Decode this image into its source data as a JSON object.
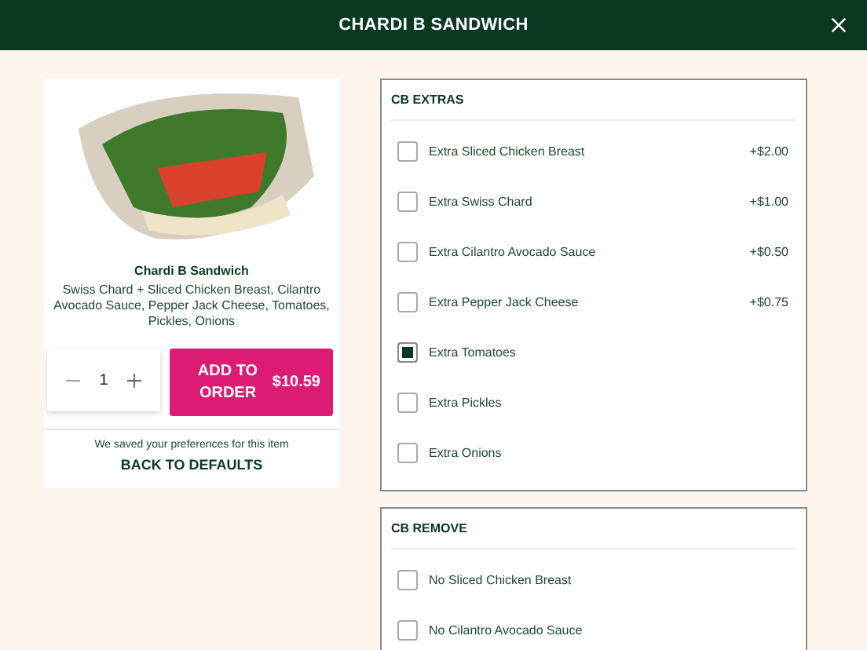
{
  "header": {
    "title": "CHARDI B SANDWICH"
  },
  "item": {
    "name": "Chardi B Sandwich",
    "description": "Swiss Chard + Sliced Chicken Breast, Cilantro Avocado Sauce, Pepper Jack Cheese, Tomatoes, Pickles, Onions",
    "quantity": "1",
    "add_button": {
      "label": "ADD TO ORDER",
      "price": "$10.59"
    },
    "saved_note": "We saved your preferences for this item",
    "reset_link": "BACK TO DEFAULTS"
  },
  "groups": [
    {
      "title": "CB EXTRAS",
      "options": [
        {
          "label": "Extra Sliced Chicken Breast",
          "price": "+$2.00",
          "checked": false
        },
        {
          "label": "Extra Swiss Chard",
          "price": "+$1.00",
          "checked": false
        },
        {
          "label": "Extra Cilantro Avocado Sauce",
          "price": "+$0.50",
          "checked": false
        },
        {
          "label": "Extra Pepper Jack Cheese",
          "price": "+$0.75",
          "checked": false
        },
        {
          "label": "Extra Tomatoes",
          "checked": true
        },
        {
          "label": "Extra Pickles",
          "checked": false
        },
        {
          "label": "Extra Onions",
          "checked": false
        }
      ]
    },
    {
      "title": "CB REMOVE",
      "options": [
        {
          "label": "No Sliced Chicken Breast",
          "checked": false
        },
        {
          "label": "No Cilantro Avocado Sauce",
          "checked": false
        }
      ]
    }
  ]
}
